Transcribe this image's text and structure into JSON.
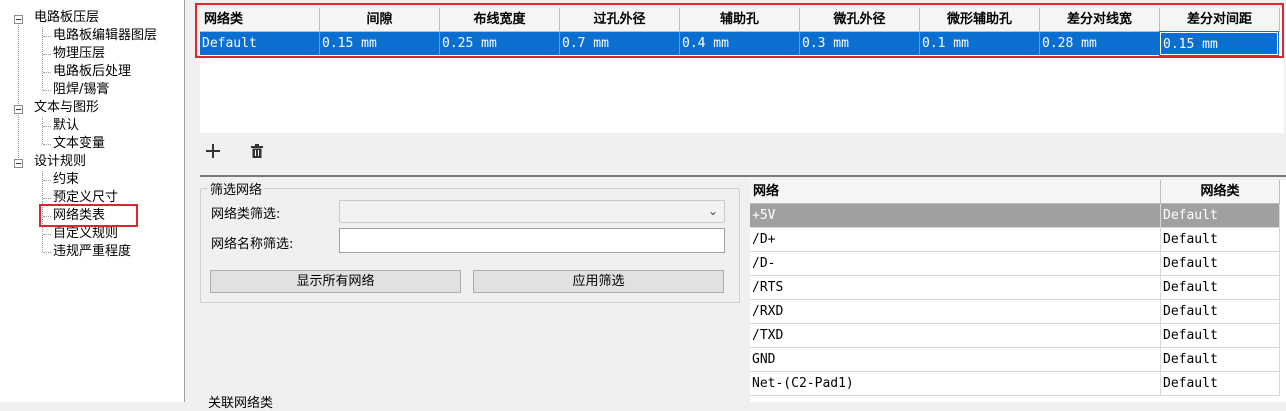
{
  "tree": {
    "items": [
      {
        "label": "电路板压层",
        "level": 0
      },
      {
        "label": "电路板编辑器图层",
        "level": 1
      },
      {
        "label": "物理压层",
        "level": 1
      },
      {
        "label": "电路板后处理",
        "level": 1
      },
      {
        "label": "阻焊/锡膏",
        "level": 1
      },
      {
        "label": "文本与图形",
        "level": 0
      },
      {
        "label": "默认",
        "level": 1
      },
      {
        "label": "文本变量",
        "level": 1
      },
      {
        "label": "设计规则",
        "level": 0
      },
      {
        "label": "约束",
        "level": 1
      },
      {
        "label": "预定义尺寸",
        "level": 1
      },
      {
        "label": "网络类表",
        "level": 1,
        "selected": true
      },
      {
        "label": "自定义规则",
        "level": 1
      },
      {
        "label": "违规严重程度",
        "level": 1
      }
    ]
  },
  "netclass_grid": {
    "headers": [
      "网络类",
      "间隙",
      "布线宽度",
      "过孔外径",
      "辅助孔",
      "微孔外径",
      "微形辅助孔",
      "差分对线宽",
      "差分对间距"
    ],
    "row": [
      "Default",
      "0.15 mm",
      "0.25 mm",
      "0.7 mm",
      "0.4 mm",
      "0.3 mm",
      "0.1 mm",
      "0.28 mm",
      "0.15 mm"
    ]
  },
  "toolbar": {
    "add_icon": "plus-icon",
    "delete_icon": "trash-icon"
  },
  "filter": {
    "title": "筛选网络",
    "class_filter_label": "网络类筛选:",
    "name_filter_label": "网络名称筛选:",
    "class_filter_value": "",
    "name_filter_value": "",
    "show_all_label": "显示所有网络",
    "apply_label": "应用筛选"
  },
  "net_table": {
    "headers": [
      "网络",
      "网络类"
    ],
    "rows": [
      [
        "+5V",
        "Default"
      ],
      [
        "/D+",
        "Default"
      ],
      [
        "/D-",
        "Default"
      ],
      [
        "/RTS",
        "Default"
      ],
      [
        "/RXD",
        "Default"
      ],
      [
        "/TXD",
        "Default"
      ],
      [
        "GND",
        "Default"
      ],
      [
        "Net-(C2-Pad1)",
        "Default"
      ]
    ]
  },
  "assoc_label": "关联网络类",
  "colors": {
    "selection": "#0a6fd0",
    "highlight_box": "#e0242f",
    "row_selected": "#a0a0a0"
  }
}
